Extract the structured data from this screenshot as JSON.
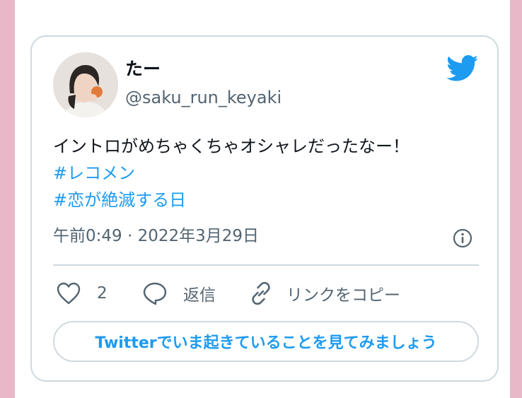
{
  "tweet": {
    "author": {
      "display_name": "たー",
      "username": "@saku_run_keyaki"
    },
    "text": "イントロがめちゃくちゃオシャレだったなー！",
    "hashtags": [
      "#レコメン",
      "#恋が絶滅する日"
    ],
    "timestamp": "午前0:49 · 2022年3月29日",
    "like_count": "2",
    "reply_label": "返信",
    "copy_link_label": "リンクをコピー",
    "cta_label": "Twitterでいま起きていることを見てみましょう"
  },
  "icons": {
    "brand": "twitter-bird-icon",
    "info": "info-icon",
    "like": "heart-icon",
    "reply": "speech-bubble-icon",
    "copy_link": "link-icon"
  },
  "colors": {
    "accent": "#1d9bf0",
    "text_primary": "#0f1419",
    "text_secondary": "#536471",
    "border": "#cfd9de",
    "page_background": "#e8b8c9"
  }
}
